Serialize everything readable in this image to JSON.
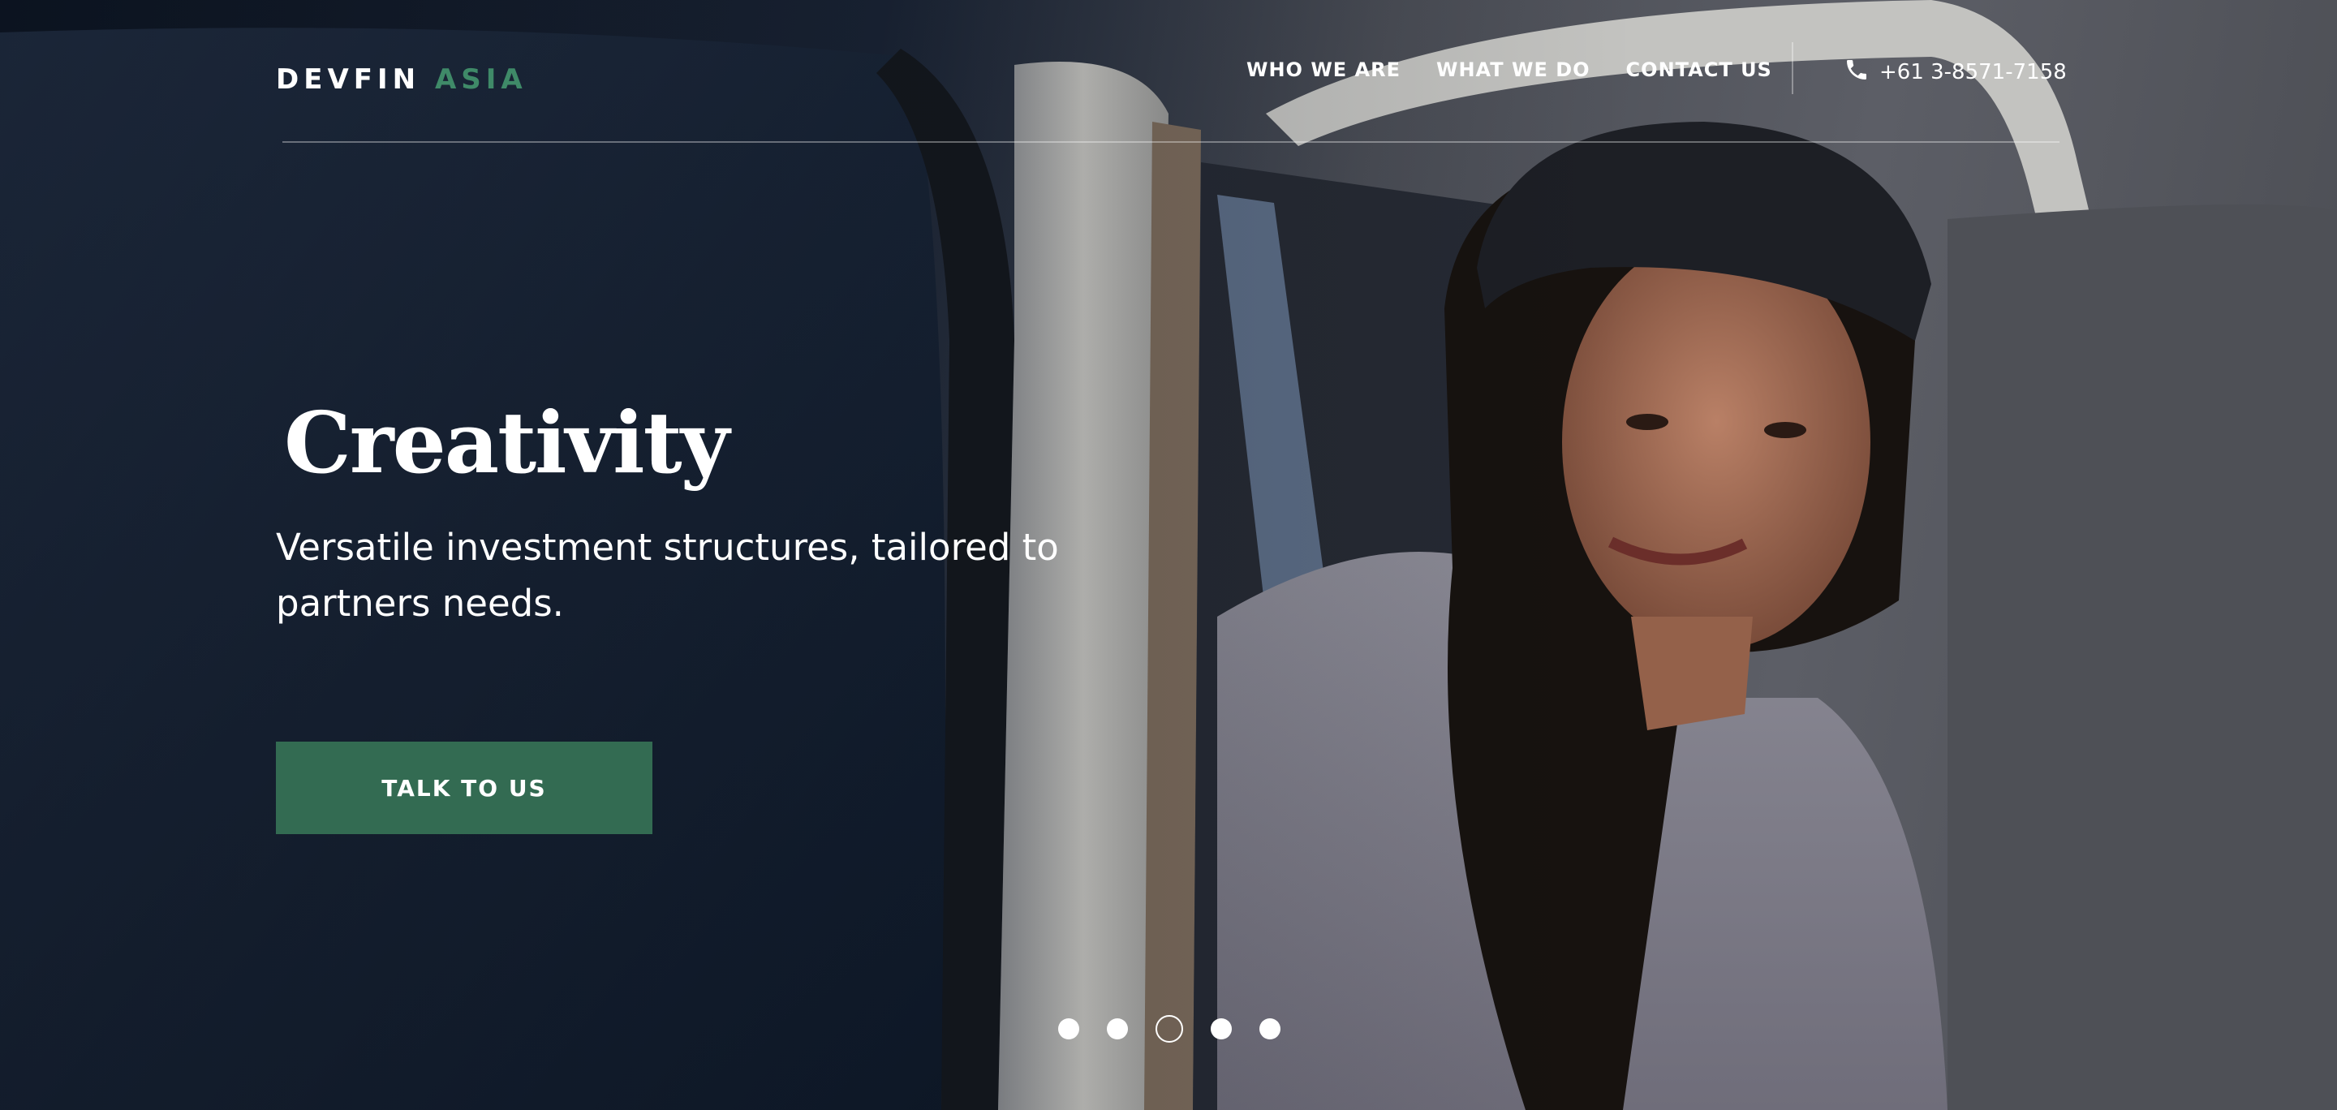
{
  "brand": {
    "name": "DEVFIN",
    "accent": "ASIA",
    "accent_color": "#3f8a68"
  },
  "nav": {
    "items": [
      {
        "label": "WHO WE ARE"
      },
      {
        "label": "WHAT WE DO"
      },
      {
        "label": "CONTACT US"
      }
    ],
    "phone": {
      "icon": "phone-icon",
      "number": "+61 3-8571-7158"
    }
  },
  "hero": {
    "headline": "Creativity",
    "subline": "Versatile investment structures, tailored to partners needs.",
    "cta_label": "TALK TO US",
    "cta_color": "#336b52"
  },
  "carousel": {
    "slide_count": 5,
    "active_index": 2
  }
}
